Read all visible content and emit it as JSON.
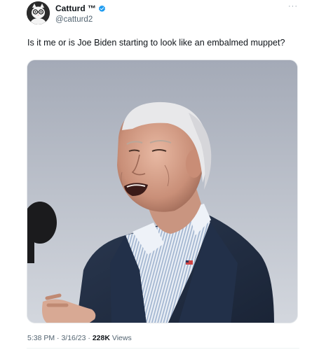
{
  "author": {
    "display_name": "Catturd ™",
    "handle": "@catturd2",
    "avatar_icon": "cat-with-glasses-avatar-icon",
    "verified_icon": "verified-badge-icon",
    "verified_color": "#1d9bf0"
  },
  "menu_icon": "more-options-icon",
  "tweet": {
    "text": "Is it me or is Joe Biden starting to look like an embalmed muppet?"
  },
  "media": {
    "description_icon": "photo-of-man-speaking-at-microphone"
  },
  "meta": {
    "time": "5:38 PM",
    "separator": "·",
    "date": "3/16/23",
    "views_count": "228K",
    "views_label": "Views"
  }
}
